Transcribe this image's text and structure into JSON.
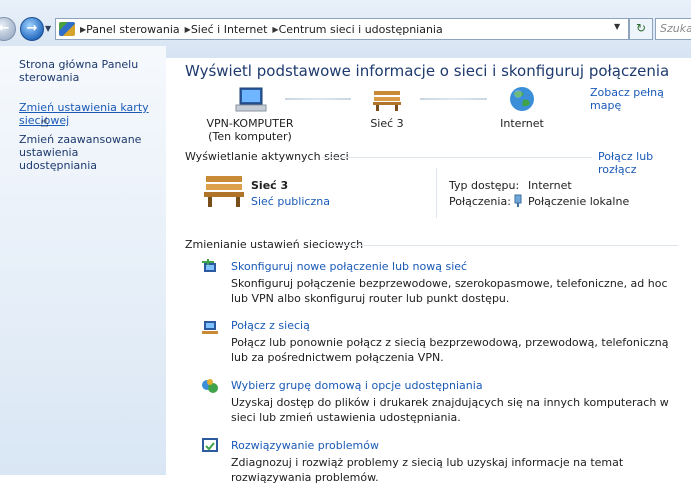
{
  "address_bar": {
    "breadcrumbs": [
      "Panel sterowania",
      "Sieć i Internet",
      "Centrum sieci i udostępniania"
    ],
    "search_placeholder": "Szuka"
  },
  "sidebar": {
    "home": "Strona główna Panelu sterowania",
    "change_adapter": "Zmień ustawienia karty sieciowej",
    "change_sharing": "Zmień zaawansowane ustawienia udostępniania"
  },
  "main": {
    "title": "Wyświetl podstawowe informacje o sieci i skonfiguruj połączenia",
    "see_full_map": "Zobacz pełną mapę",
    "map": {
      "computer_name": "VPN-KOMPUTER",
      "computer_sub": "(Ten komputer)",
      "network": "Sieć 3",
      "internet": "Internet"
    },
    "active_networks": {
      "heading": "Wyświetlanie aktywnych sieci",
      "connect_disconnect": "Połącz lub rozłącz",
      "network_name": "Sieć 3",
      "network_type": "Sieć publiczna",
      "access_type_label": "Typ dostępu:",
      "access_type_value": "Internet",
      "connections_label": "Połączenia:",
      "connections_value": "Połączenie lokalne"
    },
    "change_settings": {
      "heading": "Zmienianie ustawień sieciowych",
      "tasks": [
        {
          "title": "Skonfiguruj nowe połączenie lub nową sieć",
          "desc": "Skonfiguruj połączenie bezprzewodowe, szerokopasmowe, telefoniczne, ad hoc lub VPN albo skonfiguruj router lub punkt dostępu."
        },
        {
          "title": "Połącz z siecią",
          "desc": "Połącz lub ponownie połącz z siecią bezprzewodową, przewodową, telefoniczną lub za pośrednictwem połączenia VPN."
        },
        {
          "title": "Wybierz grupę domową i opcje udostępniania",
          "desc": "Uzyskaj dostęp do plików i drukarek znajdujących się na innych komputerach w sieci lub zmień ustawienia udostępniania."
        },
        {
          "title": "Rozwiązywanie problemów",
          "desc": "Zdiagnozuj i rozwiąż problemy z siecią lub uzyskaj informacje na temat rozwiązywania problemów."
        }
      ]
    }
  },
  "colors": {
    "link": "#1a5ab7",
    "title": "#1e3a6e",
    "sidebar_bg": "#e5eef8"
  }
}
